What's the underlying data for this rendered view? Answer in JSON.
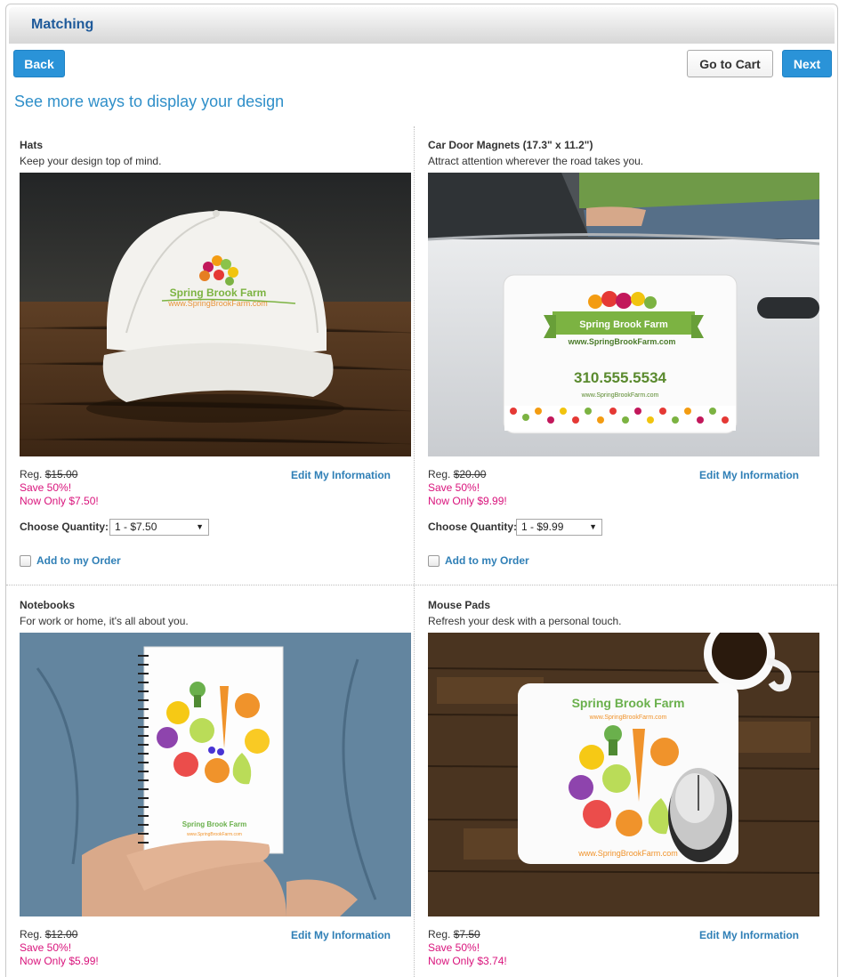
{
  "header": {
    "title": "Matching"
  },
  "toolbar": {
    "back_label": "Back",
    "cart_label": "Go to Cart",
    "next_label": "Next"
  },
  "subtitle": "See more ways to display your design",
  "products": [
    {
      "name": "Hats",
      "description": "Keep your design top of mind.",
      "reg_label": "Reg.",
      "reg_price": "$15.00",
      "save": "Save 50%!",
      "now_only": "Now Only $7.50!",
      "edit_label": "Edit My Information",
      "qty_label": "Choose Quantity:",
      "qty_value": "1 - $7.50",
      "add_label": "Add to my Order",
      "image_text": {
        "brand": "Spring Brook Farm",
        "url": "www.SpringBrookFarm.com"
      }
    },
    {
      "name": "Car Door Magnets (17.3\" x 11.2\")",
      "description": "Attract attention wherever the road takes you.",
      "reg_label": "Reg.",
      "reg_price": "$20.00",
      "save": "Save 50%!",
      "now_only": "Now Only $9.99!",
      "edit_label": "Edit My Information",
      "qty_label": "Choose Quantity:",
      "qty_value": "1 - $9.99",
      "add_label": "Add to my Order",
      "image_text": {
        "brand": "Spring Brook Farm",
        "url": "www.SpringBrookFarm.com",
        "phone": "310.555.5534",
        "url2": "www.SpringBrookFarm.com"
      }
    },
    {
      "name": "Notebooks",
      "description": "For work or home, it's all about you.",
      "reg_label": "Reg.",
      "reg_price": "$12.00",
      "save": "Save 50%!",
      "now_only": "Now Only $5.99!",
      "edit_label": "Edit My Information",
      "image_text": {
        "brand": "Spring Brook Farm",
        "url": "www.SpringBrookFarm.com"
      }
    },
    {
      "name": "Mouse Pads",
      "description": "Refresh your desk with a personal touch.",
      "reg_label": "Reg.",
      "reg_price": "$7.50",
      "save": "Save 50%!",
      "now_only": "Now Only $3.74!",
      "edit_label": "Edit My Information",
      "image_text": {
        "brand": "Spring Brook Farm",
        "url": "www.SpringBrookFarm.com",
        "url2": "www.SpringBrookFarm.com"
      }
    }
  ]
}
